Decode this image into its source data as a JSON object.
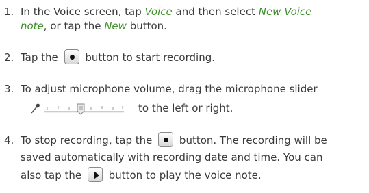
{
  "steps": [
    {
      "num": "1.",
      "a": "In the Voice screen, tap ",
      "a_em": "Voice",
      "a_rest": " and then select ",
      "a_em2": "New Voice",
      "b_em": "note",
      "b_rest": ", or tap the ",
      "b_em2": "New",
      "b_rest2": " button."
    },
    {
      "num": "2.",
      "pre": "Tap the",
      "post": "button to start recording.",
      "icon": "record-icon"
    },
    {
      "num": "3.",
      "line1": "To adjust microphone volume, drag the microphone slider",
      "line2": "to the left or right.",
      "icon": "microphone-slider-icon"
    },
    {
      "num": "4.",
      "line1_pre": "To stop recording, tap the",
      "line1_post": "button. The recording will be",
      "line2": "saved automatically with recording date and time. You can",
      "line3_pre": "also tap the",
      "line3_post": "button to play the voice note.",
      "icon_stop": "stop-icon",
      "icon_play": "play-icon"
    }
  ]
}
